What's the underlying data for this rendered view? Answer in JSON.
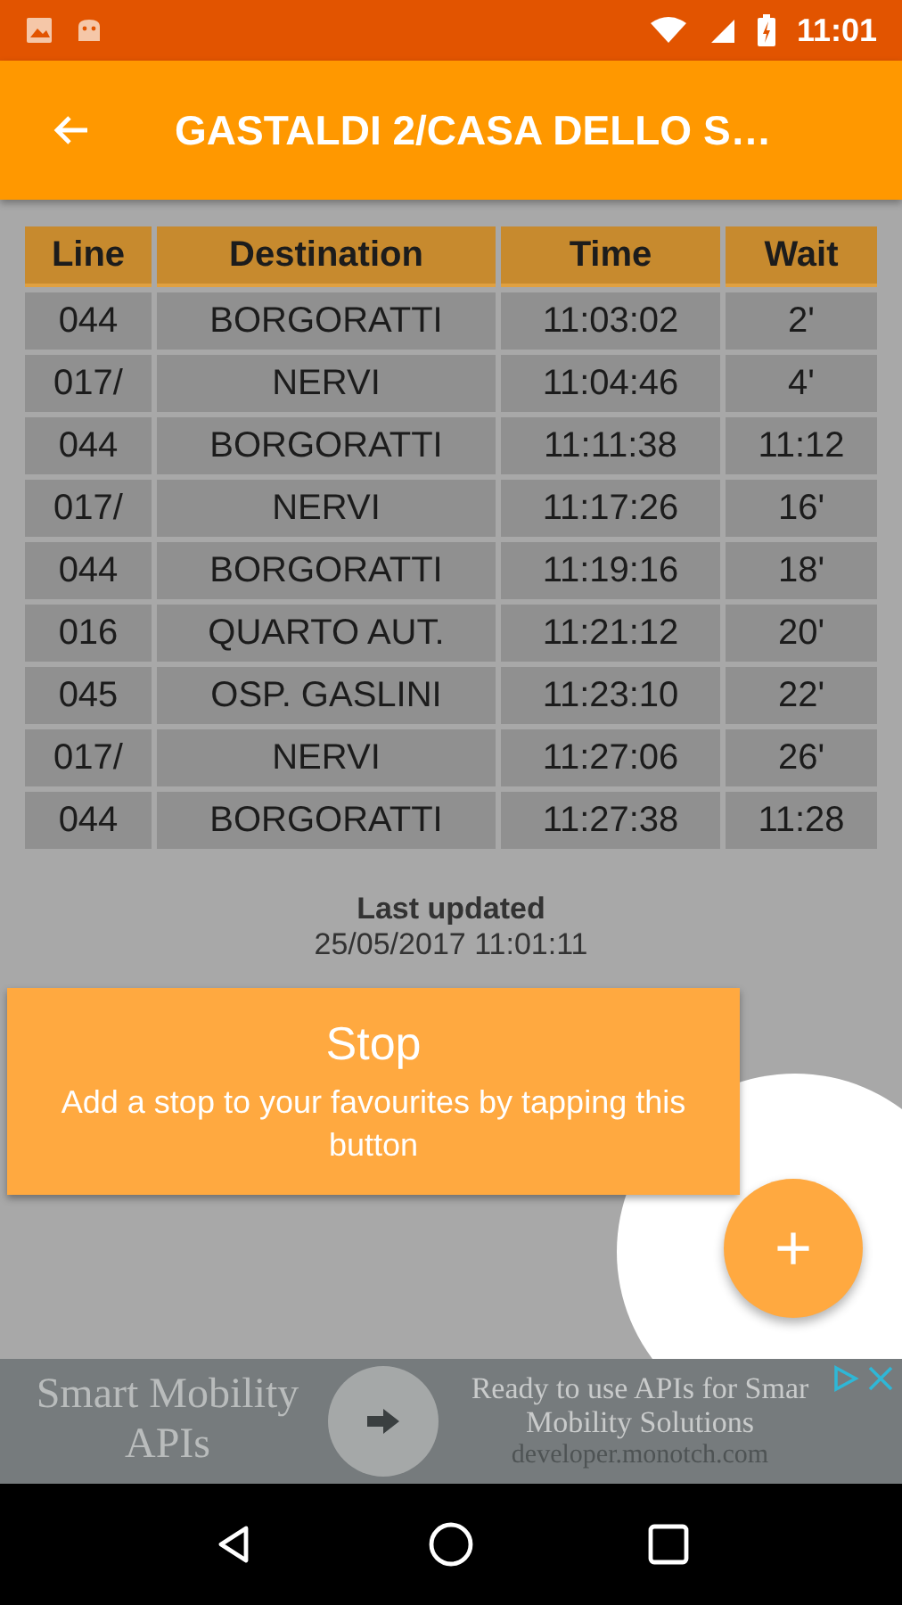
{
  "status_bar": {
    "time": "11:01"
  },
  "app_bar": {
    "title": "GASTALDI 2/CASA DELLO S…"
  },
  "table": {
    "columns": [
      "Line",
      "Destination",
      "Time",
      "Wait"
    ],
    "rows": [
      [
        "044",
        "BORGORATTI",
        "11:03:02",
        "2'"
      ],
      [
        "017/",
        "NERVI",
        "11:04:46",
        "4'"
      ],
      [
        "044",
        "BORGORATTI",
        "11:11:38",
        "11:12"
      ],
      [
        "017/",
        "NERVI",
        "11:17:26",
        "16'"
      ],
      [
        "044",
        "BORGORATTI",
        "11:19:16",
        "18'"
      ],
      [
        "016",
        "QUARTO AUT.",
        "11:21:12",
        "20'"
      ],
      [
        "045",
        "OSP. GASLINI",
        "11:23:10",
        "22'"
      ],
      [
        "017/",
        "NERVI",
        "11:27:06",
        "26'"
      ],
      [
        "044",
        "BORGORATTI",
        "11:27:38",
        "11:28"
      ]
    ]
  },
  "last_updated": {
    "label": "Last updated",
    "value": "25/05/2017 11:01:11"
  },
  "tutorial": {
    "title": "Stop",
    "text": "Add a stop to your favourites by tapping this button",
    "fab": "+"
  },
  "ad": {
    "headline": "Smart Mobility APIs",
    "text": "Ready to use APIs for Smar",
    "text_2": "Mobility Solutions",
    "url": "developer.monotch.com"
  }
}
